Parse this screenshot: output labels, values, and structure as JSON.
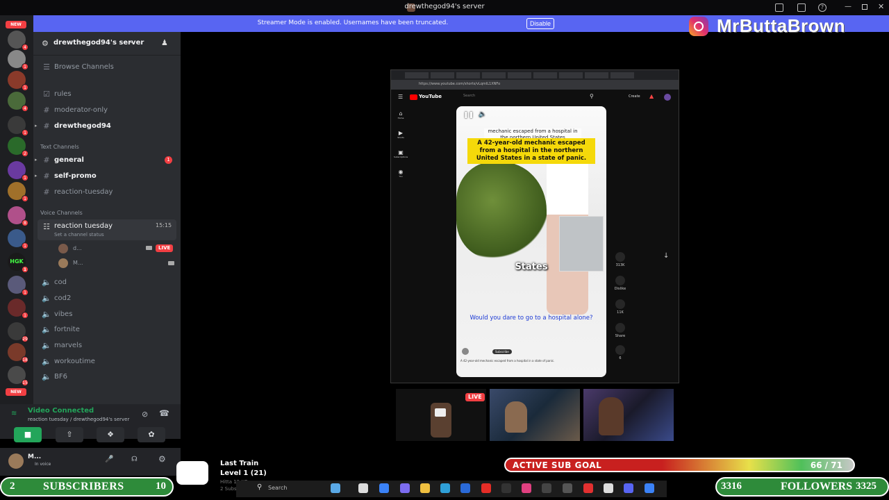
{
  "window": {
    "title": "drewthegod94's server"
  },
  "banner": {
    "text": "Streamer Mode is enabled. Usernames have been truncated.",
    "button": "Disable"
  },
  "brand": {
    "name": "MrButtaBrown"
  },
  "rail": {
    "new_label": "NEW",
    "badges": [
      "4",
      "1",
      "1",
      "4",
      "1",
      "2",
      "1",
      "1",
      "1",
      "8",
      "1",
      "1",
      "1",
      "1",
      "1",
      "1",
      "29",
      "18",
      "15",
      "1"
    ]
  },
  "sidebar": {
    "server_name": "drewthegod94's server",
    "browse": "Browse Channels",
    "channels_top": [
      {
        "label": "rules",
        "icon": "☑"
      },
      {
        "label": "moderator-only",
        "icon": "#"
      },
      {
        "label": "drewthegod94",
        "icon": "#"
      }
    ],
    "text_category": "Text Channels",
    "text_channels": [
      {
        "label": "general",
        "badge": "1"
      },
      {
        "label": "self-promo"
      },
      {
        "label": "reaction-tuesday"
      }
    ],
    "voice_category": "Voice Channels",
    "active_voice": {
      "label": "reaction tuesday",
      "time": "15:15",
      "status": "Set a channel status"
    },
    "voice_users": [
      {
        "name": "d...",
        "live": "LIVE"
      },
      {
        "name": "M..."
      }
    ],
    "voice_channels": [
      "cod",
      "cod2",
      "vibes",
      "fortnite",
      "marvels",
      "workoutime",
      "BF6"
    ]
  },
  "voice_panel": {
    "title": "Video Connected",
    "subtitle": "reaction tuesday / drewthegod94's server"
  },
  "user_panel": {
    "name": "M...",
    "status": "In voice"
  },
  "video": {
    "url": "https://www.youtube.com/shorts/vLqmIL1XNFo",
    "yt_logo": "YouTube",
    "search_placeholder": "Search",
    "create_label": "Create",
    "small_caption": "mechanic escaped from a hospital in the northern United States",
    "caption": "A 42-year-old mechanic escaped from a hospital in the northern United States in a state of panic.",
    "word": "States",
    "question": "Would you dare to go to a hospital alone?",
    "subscribe": "Subscribe",
    "desc": "A 42-year-old mechanic escaped from a hospital in a state of panic.",
    "actions": [
      {
        "label": "313K"
      },
      {
        "label": "Dislike"
      },
      {
        "label": "11K"
      },
      {
        "label": "Share"
      },
      {
        "label": "6"
      }
    ],
    "nav": [
      "Home",
      "Shorts",
      "Subscriptions",
      "You"
    ]
  },
  "cams": {
    "live_label": "LIVE"
  },
  "overlay": {
    "sub_goal_label": "ACTIVE SUB GOAL",
    "sub_goal_value": "66 / 71",
    "sub_goal_progress": 0.93,
    "subscribers_left": "2",
    "subscribers_label": "SUBSCRIBERS",
    "subscribers_right": "10",
    "followers_left": "3316",
    "followers_label": "FOLLOWERS",
    "followers_right": "3325",
    "music_title": "Last Train",
    "music_level": "Level 1 (21)",
    "music_sub1": "Hitta 12 XP",
    "music_sub2": "2 Subs"
  },
  "taskbar": {
    "search": "Search"
  }
}
